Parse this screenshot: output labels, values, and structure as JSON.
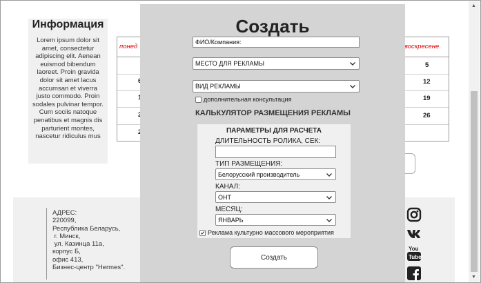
{
  "info": {
    "title": "Информация",
    "text": "Lorem ipsum dolor sit amet, consectetur adipiscing elit. Aenean euismod bibendum laoreet. Proin gravida dolor sit amet lacus accumsan et viverra justo commodo. Proin sodales pulvinar tempor. Cum sociis natoque penatibus et magnis dis parturient montes, nascetur ridiculus mus"
  },
  "calendar": {
    "headers": {
      "first": "понед",
      "last": "воскресене"
    },
    "left_col": [
      "",
      "6",
      "1",
      "2",
      "2"
    ],
    "right_col": [
      "5",
      "12",
      "19",
      "26",
      ""
    ]
  },
  "footer": {
    "address": "АДРЕС:\n220099,\nРеспублика Беларусь,\n г. Минск,\n ул. Казинца 11а,\nкорпус Б,\nофис 413,\nБизнес-центр \"Hermes\"."
  },
  "social": [
    "instagram-icon",
    "vk-icon",
    "youtube-icon",
    "facebook-icon"
  ],
  "modal": {
    "title": "Создать",
    "name_field": "ФИО/Компания:",
    "place_select": "МЕСТО ДЛЯ РЕКЛАМЫ",
    "type_select": "ВИД РЕКЛАМЫ",
    "consult_label": "дополнительная консультация",
    "consult_checked": false,
    "calc_title": "КАЛЬКУЛЯТОР РАЗМЕЩЕНИЯ РЕКЛАМЫ",
    "params": {
      "title": "ПАРАМЕТРЫ ДЛЯ РАСЧЕТА",
      "duration_label": "ДЛИТЕЛЬНОСТЬ РОЛИКА, СЕК:",
      "duration_value": "",
      "placement_label": "ТИП РАЗМЕЩЕНИЯ:",
      "placement_value": "Белорусский производитель",
      "channel_label": "КАНАЛ:",
      "channel_value": "ОНТ",
      "month_label": "МЕСЯЦ:",
      "month_value": "ЯНВАРЬ",
      "culture_label": "Реклама культурно массового мероприятия",
      "culture_checked": true
    },
    "submit_label": "Создать"
  },
  "colors": {
    "modal_bg": "#d4d4d4",
    "accent_red": "#e00000"
  }
}
